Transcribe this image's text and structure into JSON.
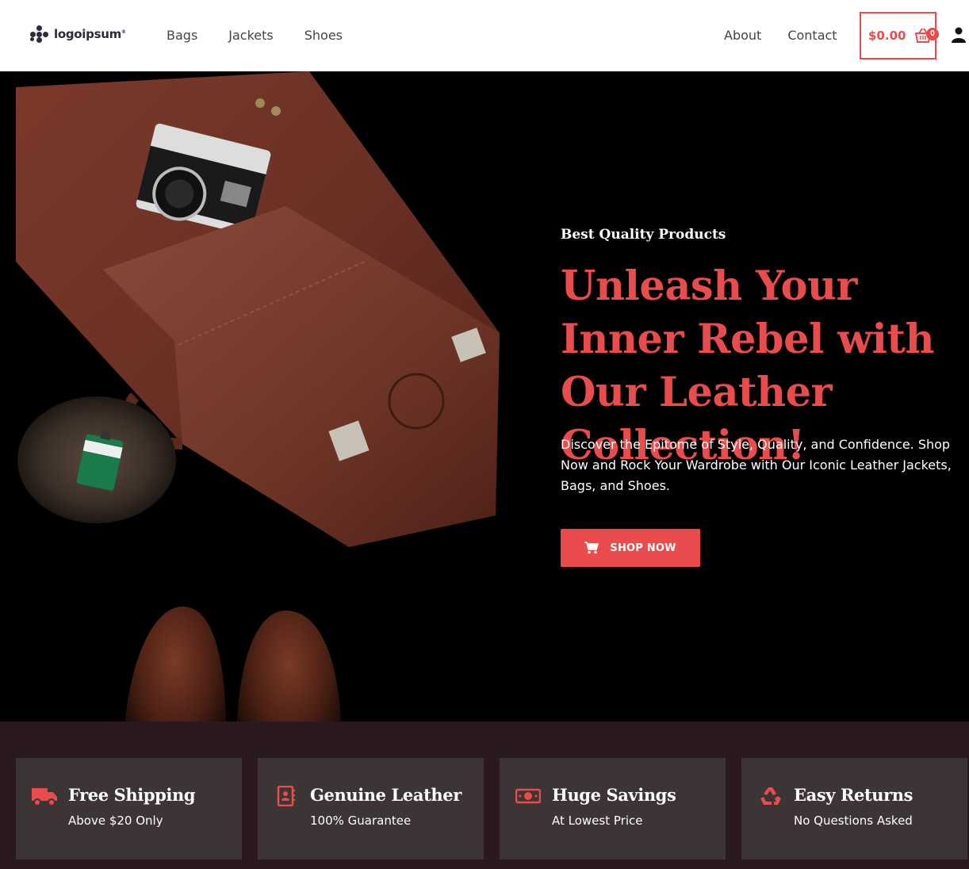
{
  "brand": {
    "logo_text": "logoipsum"
  },
  "nav": {
    "left": [
      "Bags",
      "Jackets",
      "Shoes"
    ],
    "right": [
      "About",
      "Contact"
    ]
  },
  "cart": {
    "total": "$0.00",
    "count": "0",
    "icon": "basket-icon"
  },
  "account": {
    "icon": "user-icon"
  },
  "hero": {
    "eyebrow": "Best Quality Products",
    "headline": "Unleash Your Inner Rebel with Our Leather Collection!",
    "lead": "Discover the Epitome of Style, Quality, and Confidence. Shop Now and Rock Your Wardrobe with Our Iconic Leather Jackets, Bags, and Shoes.",
    "cta_label": "SHOP NOW",
    "cta_icon": "cart-icon"
  },
  "features": [
    {
      "title": "Free Shipping",
      "subtitle": "Above $20 Only",
      "icon": "truck-icon"
    },
    {
      "title": "Genuine Leather",
      "subtitle": "100% Guarantee",
      "icon": "contact-book-icon"
    },
    {
      "title": "Huge Savings",
      "subtitle": "At Lowest Price",
      "icon": "money-bill-icon"
    },
    {
      "title": "Easy Returns",
      "subtitle": "No Questions Asked",
      "icon": "recycle-icon"
    }
  ],
  "colors": {
    "accent": "#e84c4c",
    "hero_bg": "#000000",
    "features_bg": "#2a1a1e",
    "card_bg": "#3c3435"
  }
}
